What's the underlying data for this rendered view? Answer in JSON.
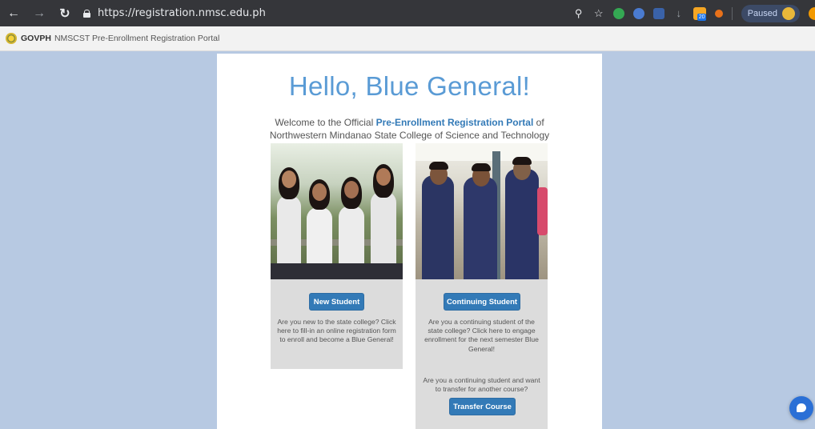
{
  "browser": {
    "url": "https://registration.nmsc.edu.ph",
    "profile_status": "Paused",
    "extension_badge": "20"
  },
  "govbar": {
    "brand": "GOVPH",
    "title": "NMSCST Pre-Enrollment Registration Portal"
  },
  "main": {
    "greeting": "Hello, Blue General!",
    "welcome_prefix": "Welcome to the Official",
    "welcome_highlight": "Pre-Enrollment Registration Portal",
    "welcome_suffix": "of",
    "welcome_line2": "Northwestern Mindanao State College of Science and Technology"
  },
  "new_student": {
    "button_label": "New Student",
    "description": "Are you new to the state college? Click here to fill-in an online registration form to enroll and become a Blue General!"
  },
  "continuing_student": {
    "button_label": "Continuing Student",
    "description": "Are you a continuing student of the state college? Click here to engage enrollment for the next semester Blue General!",
    "transfer_text": "Are you a continuing student and want to transfer for another course?",
    "transfer_button_label": "Transfer Course"
  },
  "colors": {
    "accent": "#337ab7",
    "greeting": "#5a9bd5",
    "page_bg": "#b7c9e2"
  }
}
